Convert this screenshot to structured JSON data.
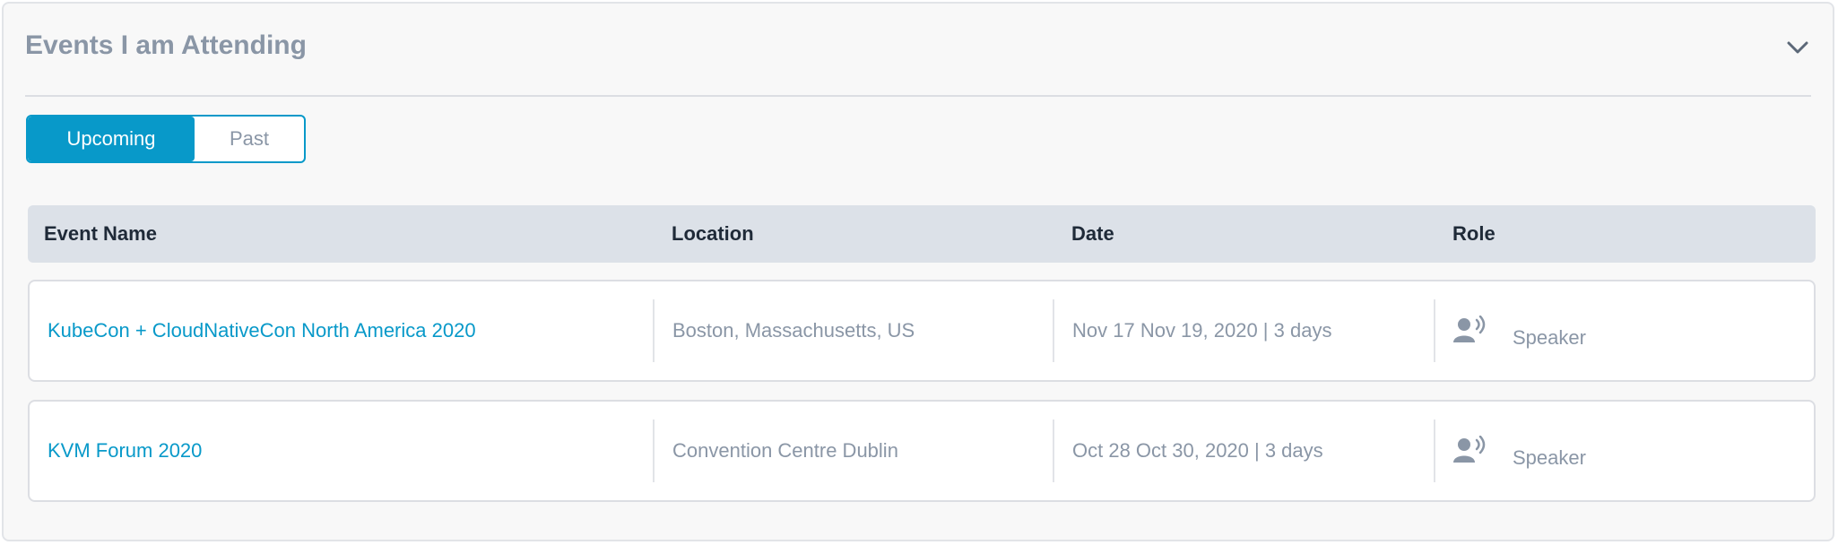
{
  "panel": {
    "title": "Events I am Attending",
    "collapse_icon": "chevron-down-icon"
  },
  "tabs": {
    "upcoming": "Upcoming",
    "past": "Past",
    "selected": "Upcoming"
  },
  "table": {
    "headers": {
      "event_name": "Event Name",
      "location": "Location",
      "date": "Date",
      "role": "Role"
    },
    "rows": [
      {
        "event_name": "KubeCon + CloudNativeCon North America 2020",
        "location": "Boston, Massachusetts, US",
        "date": "Nov 17 Nov 19, 2020 | 3 days",
        "role": "Speaker",
        "role_icon": "speaker-person-icon"
      },
      {
        "event_name": "KVM Forum 2020",
        "location": "Convention Centre Dublin",
        "date": "Oct 28 Oct 30, 2020 | 3 days",
        "role": "Speaker",
        "role_icon": "speaker-person-icon"
      }
    ]
  },
  "colors": {
    "accent": "#0899c9",
    "muted_text": "#8a96a6",
    "header_bg": "#dce1e8"
  }
}
